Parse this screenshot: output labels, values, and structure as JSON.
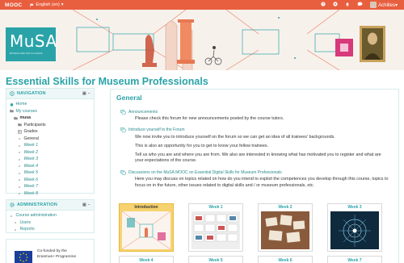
{
  "topbar": {
    "brand": "MOOC",
    "language": "English (en)",
    "user": "Achilles",
    "icons": [
      "help-icon",
      "settings-icon",
      "bell-icon",
      "chat-icon"
    ]
  },
  "banner": {
    "logo_text": "MuSA",
    "logo_sub": "MUSEUM SECTOR ALLIANCE"
  },
  "page": {
    "title": "Essential Skills for Museum Professionals"
  },
  "navigation": {
    "header": "NAVIGATION",
    "items": [
      {
        "label": "Home",
        "style": "link",
        "indent": 0,
        "icon": "home-icon"
      },
      {
        "label": "My courses",
        "style": "link",
        "indent": 0,
        "icon": "folder-icon"
      },
      {
        "label": "musa",
        "style": "bold",
        "indent": 1,
        "icon": "folder-icon"
      },
      {
        "label": "Participants",
        "style": "plain",
        "indent": 2,
        "icon": "folder-icon"
      },
      {
        "label": "Grades",
        "style": "plain",
        "indent": 2,
        "icon": "grades-icon"
      },
      {
        "label": "General",
        "style": "plain",
        "indent": 2,
        "icon": "bullet-icon"
      },
      {
        "label": "Week 1",
        "style": "ital",
        "indent": 2,
        "icon": "bullet-icon"
      },
      {
        "label": "Week 2",
        "style": "ital",
        "indent": 2,
        "icon": "bullet-icon"
      },
      {
        "label": "Week 3",
        "style": "ital",
        "indent": 2,
        "icon": "bullet-icon"
      },
      {
        "label": "Week 4",
        "style": "ital",
        "indent": 2,
        "icon": "bullet-icon"
      },
      {
        "label": "Week 5",
        "style": "ital",
        "indent": 2,
        "icon": "bullet-icon"
      },
      {
        "label": "Week 6",
        "style": "ital",
        "indent": 2,
        "icon": "bullet-icon"
      },
      {
        "label": "Week 7",
        "style": "ital",
        "indent": 2,
        "icon": "bullet-icon"
      },
      {
        "label": "Week 8",
        "style": "ital",
        "indent": 2,
        "icon": "bullet-icon"
      }
    ]
  },
  "administration": {
    "header": "ADMINISTRATION",
    "items": [
      {
        "label": "Course administration",
        "style": "link",
        "indent": 0
      },
      {
        "label": "Users",
        "style": "link",
        "indent": 1
      },
      {
        "label": "Reports",
        "style": "link",
        "indent": 1
      }
    ]
  },
  "funding": {
    "line1": "Co-funded by the",
    "line2": "Erasmus+ Programme"
  },
  "main": {
    "section_title": "General",
    "forums": [
      {
        "title": "Announcements",
        "paragraphs": [
          "Please check this forum for new announcements posted by the course tutors."
        ]
      },
      {
        "title": "Introduce yourself to the Forum",
        "paragraphs": [
          "We now invite you to introduce yourself on the forum so we can get an idea of all trainees' backgrounds.",
          "This is also an opportunity for you to get to know your fellow trainees.",
          "Tell us who you are and where you are from. We also are interested in knowing what has motivated you to register and what are your expectations of the course."
        ]
      },
      {
        "title": "Discussions on the MuSA MOOC on Essential Digital Skills for Museum Professionals",
        "paragraphs": [
          "Here you may discuss on topics related on how do you intend to exploit the competences you develop through this course, topics to focus on in the future, other issues related to digital skills and / or museum professionals, etc."
        ]
      }
    ],
    "tiles_row1": [
      "Introduction",
      "Week 1",
      "Week 2",
      "Week 3"
    ],
    "tiles_row2": [
      "Week 4",
      "Week 5",
      "Week 6",
      "Week 7"
    ]
  },
  "colors": {
    "topbar": "#e85f3f",
    "accent": "#2aa3a8",
    "active_tile": "#f6d36f"
  }
}
